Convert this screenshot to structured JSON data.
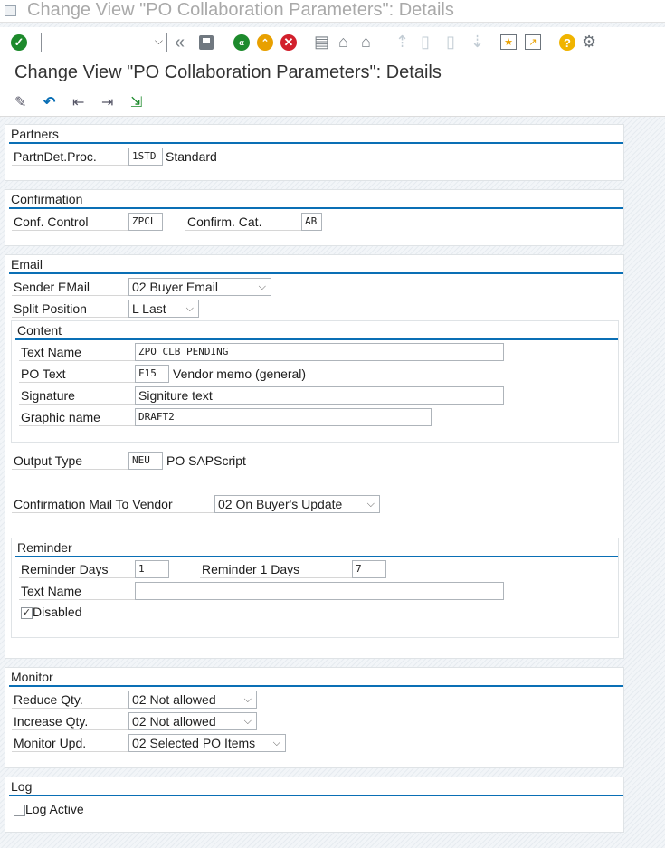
{
  "window": {
    "title": "Change View \"PO Collaboration Parameters\": Details"
  },
  "toolbar": {
    "command_placeholder": "",
    "icons": [
      "enter-icon",
      "back-double-icon",
      "save-icon",
      "back-icon",
      "exit-icon",
      "cancel-icon",
      "print-icon",
      "find-icon",
      "find-next-icon",
      "first-page-icon",
      "previous-page-icon",
      "next-page-icon",
      "last-page-icon",
      "create-session-icon",
      "shortcut-icon",
      "help-icon",
      "settings-icon"
    ]
  },
  "header": {
    "title": "Change View \"PO Collaboration Parameters\": Details"
  },
  "partners": {
    "title": "Partners",
    "partndet_label": "PartnDet.Proc.",
    "partndet_value": "1STD",
    "partndet_desc": "Standard"
  },
  "confirmation": {
    "title": "Confirmation",
    "conf_control_label": "Conf. Control",
    "conf_control_value": "ZPCL",
    "confirm_cat_label": "Confirm. Cat.",
    "confirm_cat_value": "AB"
  },
  "email": {
    "title": "Email",
    "sender_label": "Sender EMail",
    "sender_value": "02 Buyer Email",
    "split_label": "Split Position",
    "split_value": "L Last",
    "content": {
      "title": "Content",
      "text_name_label": "Text Name",
      "text_name_value": "ZPO_CLB_PENDING",
      "po_text_label": "PO Text",
      "po_text_value": "F15",
      "po_text_desc": "Vendor memo (general)",
      "signature_label": "Signature",
      "signature_value": "Signiture text",
      "graphic_label": "Graphic name",
      "graphic_value": "DRAFT2"
    },
    "output_type_label": "Output Type",
    "output_type_value": "NEU",
    "output_type_desc": "PO SAPScript",
    "conf_mail_label": "Confirmation Mail To Vendor",
    "conf_mail_value": "02 On Buyer's Update",
    "reminder": {
      "title": "Reminder",
      "days_label": "Reminder Days",
      "days_value": "1",
      "days1_label": "Reminder 1 Days",
      "days1_value": "7",
      "text_name_label": "Text Name",
      "text_name_value": "",
      "disabled_label": "Disabled",
      "disabled_checked": true
    }
  },
  "monitor": {
    "title": "Monitor",
    "reduce_label": "Reduce Qty.",
    "reduce_value": "02 Not allowed",
    "increase_label": "Increase Qty.",
    "increase_value": "02 Not allowed",
    "upd_label": "Monitor Upd.",
    "upd_value": "02 Selected PO Items"
  },
  "log": {
    "title": "Log",
    "active_label": "Log Active",
    "active_checked": false
  },
  "colors": {
    "accent": "#0a6fb5",
    "enter_green": "#1d8a2c",
    "cancel_red": "#d2202c",
    "exit_yellow": "#e8a000",
    "help_yellow": "#f0b400"
  }
}
